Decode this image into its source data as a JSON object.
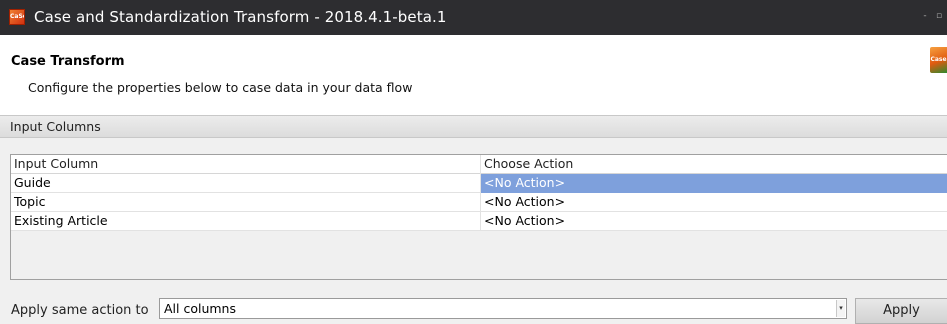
{
  "window": {
    "title": "Case and Standardization Transform - 2018.4.1-beta.1",
    "app_icon_text": "CaSe",
    "minimize_label": "-",
    "maximize_label": "▫"
  },
  "header": {
    "title": "Case Transform",
    "description": "Configure the properties below to case data in your data flow",
    "corner_icon_text": "Case"
  },
  "section": {
    "title": "Input Columns"
  },
  "grid": {
    "columns": [
      "Input Column",
      "Choose Action"
    ],
    "rows": [
      {
        "column": "Guide",
        "action": "<No Action>"
      },
      {
        "column": "Topic",
        "action": "<No Action>"
      },
      {
        "column": "Existing Article",
        "action": "<No Action>"
      }
    ],
    "selected_color": "#7ea0dc"
  },
  "footer": {
    "apply_label": "Apply same action to",
    "combo_value": "All columns",
    "combo_arrow": "▾",
    "apply_button": "Apply"
  }
}
